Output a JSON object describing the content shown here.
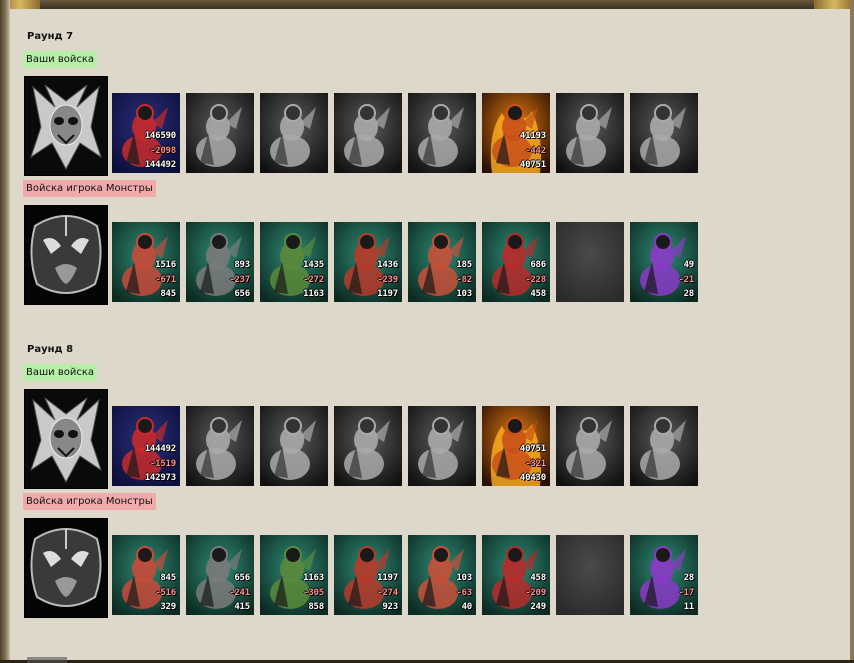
{
  "colors": {
    "own_label_bg": "#b6f0a8",
    "enemy_label_bg": "#f0aaaa",
    "loss": "#ff9090",
    "panel": "#ded8cb"
  },
  "rounds": [
    {
      "title": "Раунд 7",
      "own": {
        "label": "Ваши войска",
        "portrait_icon": "demon-skull-emblem-icon",
        "units": [
          {
            "icon": "red-dragon-unit-icon",
            "tint": "blue",
            "before": "146590",
            "loss": "-2098",
            "after": "144492"
          },
          {
            "icon": "skeleton-warrior-icon",
            "tint": "gray"
          },
          {
            "icon": "ghost-beast-icon",
            "tint": "gray"
          },
          {
            "icon": "bone-dragon-icon",
            "tint": "gray"
          },
          {
            "icon": "shadow-brute-icon",
            "tint": "gray"
          },
          {
            "icon": "fire-lich-icon",
            "tint": "fire",
            "before": "41193",
            "loss": "-442",
            "after": "40751"
          },
          {
            "icon": "horned-knight-icon",
            "tint": "gray"
          },
          {
            "icon": "wraith-icon",
            "tint": "gray"
          }
        ]
      },
      "enemy": {
        "label": "Войска игрока Монстры",
        "portrait_icon": "dark-tribal-mask-icon",
        "units": [
          {
            "icon": "sea-serpent-icon",
            "tint": "teal",
            "before": "1516",
            "loss": "-671",
            "after": "845"
          },
          {
            "icon": "armored-ogre-icon",
            "tint": "teal",
            "before": "893",
            "loss": "-237",
            "after": "656"
          },
          {
            "icon": "orc-shieldbearer-icon",
            "tint": "teal",
            "before": "1435",
            "loss": "-272",
            "after": "1163"
          },
          {
            "icon": "red-demon-icon",
            "tint": "teal",
            "before": "1436",
            "loss": "-239",
            "after": "1197"
          },
          {
            "icon": "spider-creature-icon",
            "tint": "teal",
            "before": "185",
            "loss": "-82",
            "after": "103"
          },
          {
            "icon": "red-wyvern-icon",
            "tint": "teal",
            "before": "686",
            "loss": "-228",
            "after": "458"
          },
          {
            "icon": "empty-slot-icon",
            "tint": "empty"
          },
          {
            "icon": "naga-sorceress-icon",
            "tint": "teal",
            "before": "49",
            "loss": "-21",
            "after": "28"
          }
        ]
      }
    },
    {
      "title": "Раунд 8",
      "own": {
        "label": "Ваши войска",
        "portrait_icon": "demon-skull-emblem-icon",
        "units": [
          {
            "icon": "red-dragon-unit-icon",
            "tint": "blue",
            "before": "144492",
            "loss": "-1519",
            "after": "142973"
          },
          {
            "icon": "skeleton-warrior-icon",
            "tint": "gray"
          },
          {
            "icon": "ghost-beast-icon",
            "tint": "gray"
          },
          {
            "icon": "bone-dragon-icon",
            "tint": "gray"
          },
          {
            "icon": "shadow-brute-icon",
            "tint": "gray"
          },
          {
            "icon": "fire-lich-icon",
            "tint": "fire",
            "before": "40751",
            "loss": "-321",
            "after": "40430"
          },
          {
            "icon": "horned-knight-icon",
            "tint": "gray"
          },
          {
            "icon": "wraith-icon",
            "tint": "gray"
          }
        ]
      },
      "enemy": {
        "label": "Войска игрока Монстры",
        "portrait_icon": "dark-tribal-mask-icon",
        "units": [
          {
            "icon": "sea-serpent-icon",
            "tint": "teal",
            "before": "845",
            "loss": "-516",
            "after": "329"
          },
          {
            "icon": "armored-ogre-icon",
            "tint": "teal",
            "before": "656",
            "loss": "-241",
            "after": "415"
          },
          {
            "icon": "orc-shieldbearer-icon",
            "tint": "teal",
            "before": "1163",
            "loss": "-305",
            "after": "858"
          },
          {
            "icon": "red-demon-icon",
            "tint": "teal",
            "before": "1197",
            "loss": "-274",
            "after": "923"
          },
          {
            "icon": "spider-creature-icon",
            "tint": "teal",
            "before": "103",
            "loss": "-63",
            "after": "40"
          },
          {
            "icon": "red-wyvern-icon",
            "tint": "teal",
            "before": "458",
            "loss": "-209",
            "after": "249"
          },
          {
            "icon": "empty-slot-icon",
            "tint": "empty"
          },
          {
            "icon": "naga-sorceress-icon",
            "tint": "teal",
            "before": "28",
            "loss": "-17",
            "after": "11"
          }
        ]
      }
    }
  ]
}
